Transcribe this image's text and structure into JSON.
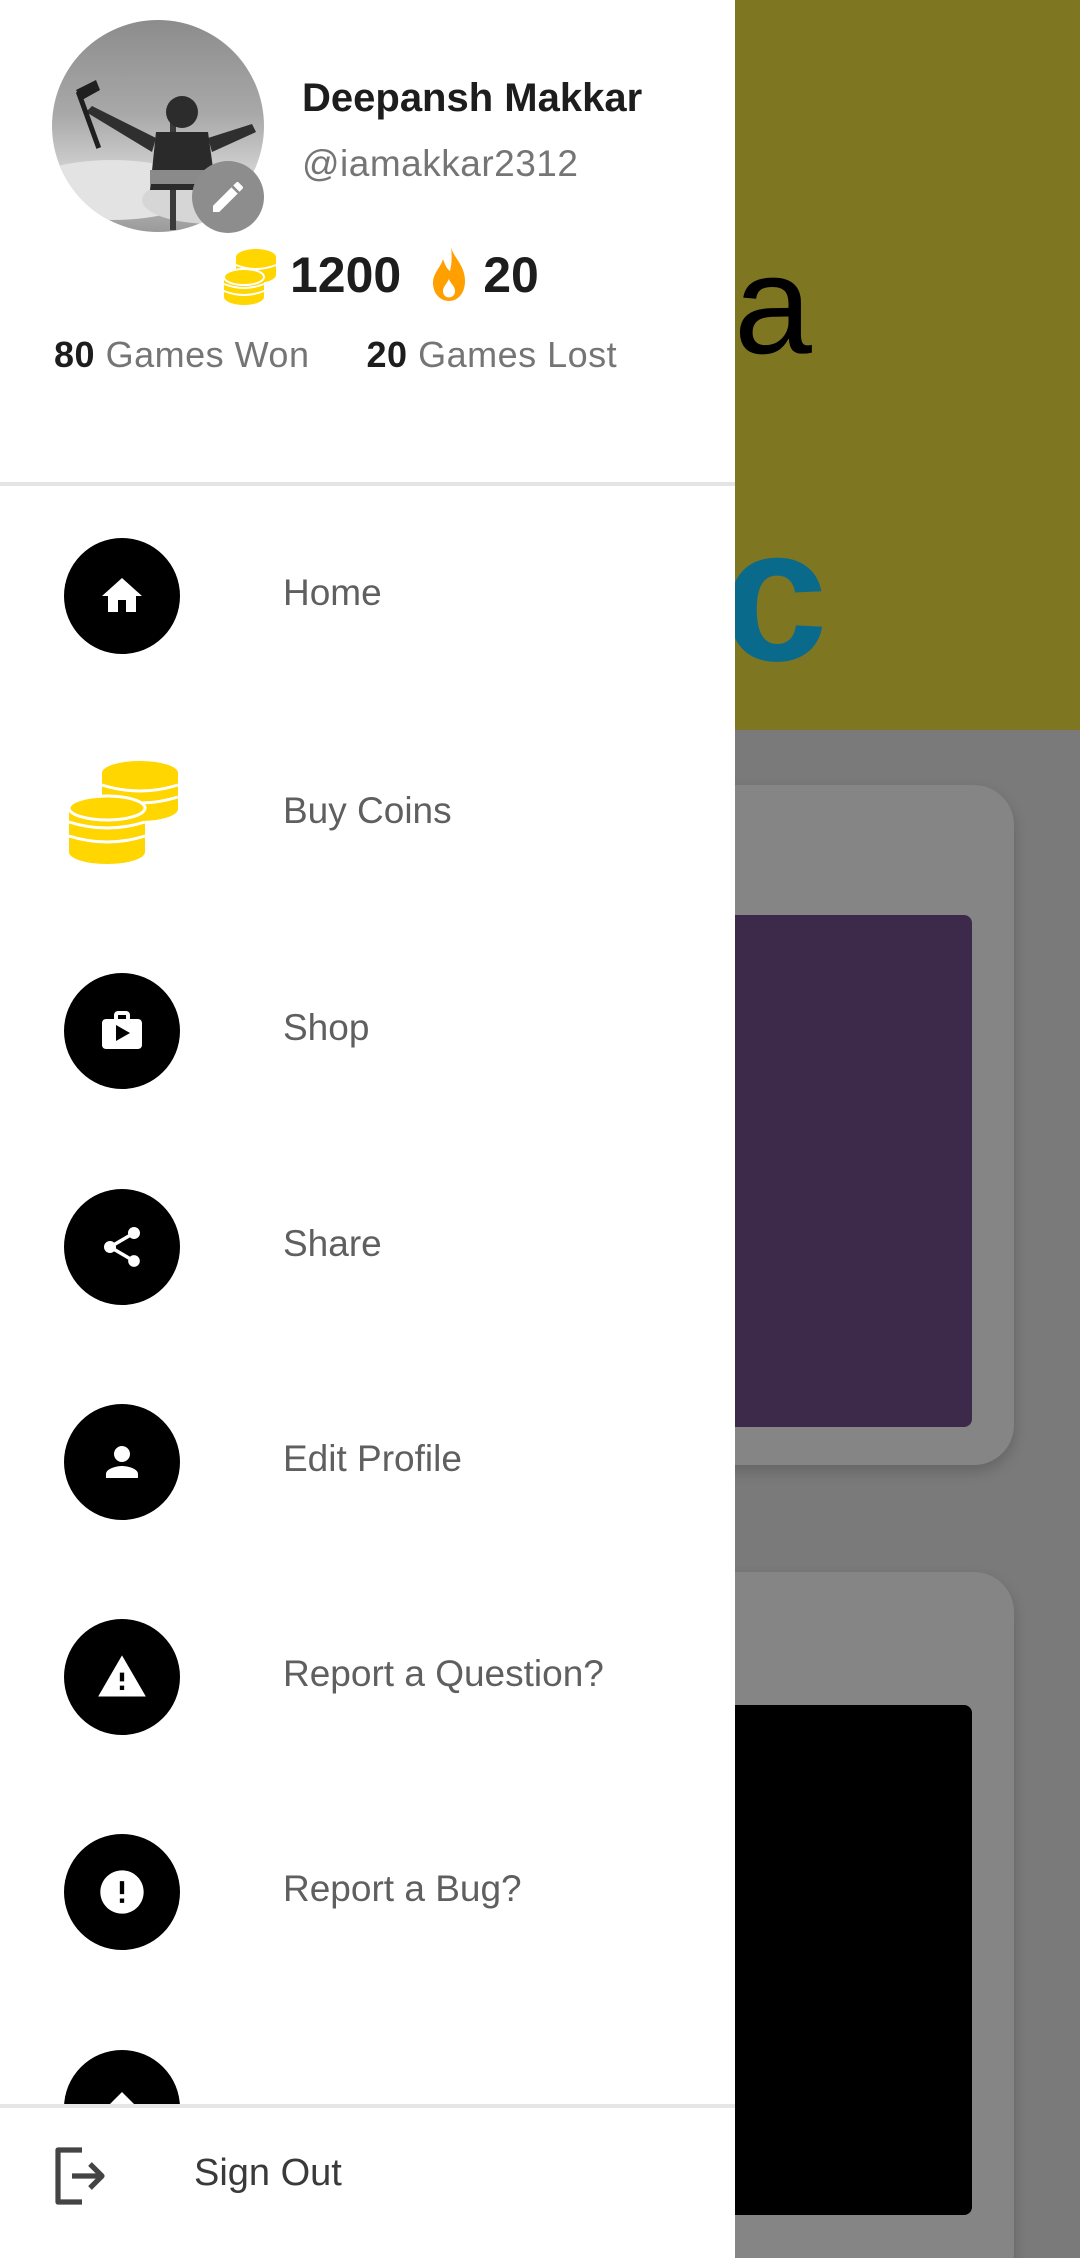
{
  "profile": {
    "name": "Deepansh Makkar",
    "handle": "@iamakkar2312",
    "coins": "1200",
    "streak": "20",
    "games_won": "80",
    "games_won_label": "Games Won",
    "games_lost": "20",
    "games_lost_label": "Games Lost"
  },
  "menu": {
    "items": [
      {
        "label": "Home",
        "icon": "home-icon"
      },
      {
        "label": "Buy Coins",
        "icon": "coins-icon"
      },
      {
        "label": "Shop",
        "icon": "shopping-bag-icon"
      },
      {
        "label": "Share",
        "icon": "share-icon"
      },
      {
        "label": "Edit Profile",
        "icon": "person-icon"
      },
      {
        "label": "Report a Question?",
        "icon": "warning-icon"
      },
      {
        "label": "Report a Bug?",
        "icon": "error-icon"
      }
    ]
  },
  "footer": {
    "signout_label": "Sign Out",
    "icon": "logout-icon"
  },
  "colors": {
    "coin": "#FFD600",
    "flame": "#FFA000",
    "icon_bg": "#000000",
    "background_top": "#7F7622",
    "background_card_purple": "#3D2A4A"
  }
}
